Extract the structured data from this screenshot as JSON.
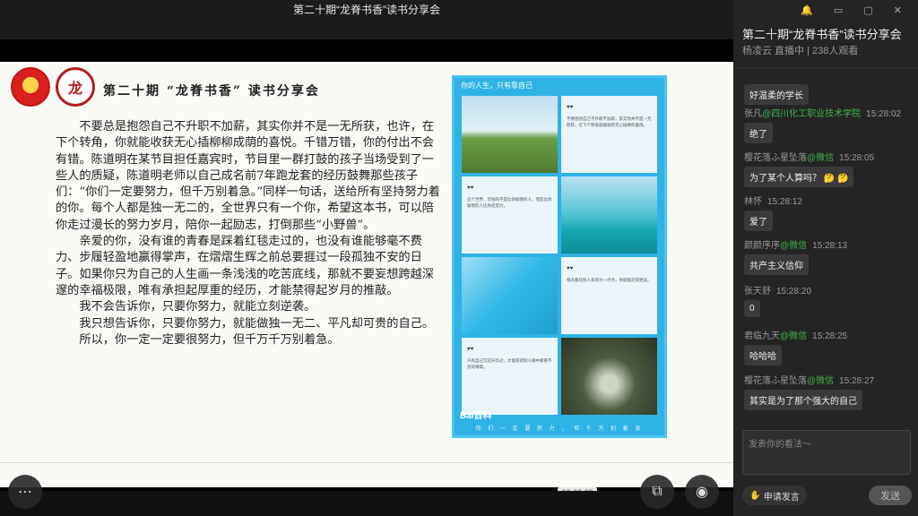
{
  "video": {
    "title": "第二十期“龙脊书香”读书分享会",
    "timecode": "06:02.68"
  },
  "slide": {
    "logo2_char": "龙",
    "heading": "第二十期 “龙脊书香” 读书分享会",
    "paragraphs": [
      "不要总是抱怨自己不升职不加薪，其实你并不是一无所获，也许，在下个转角，你就能收获无心插柳柳成荫的喜悦。千错万错，你的付出不会有错。陈道明在某节目担任嘉宾时，节目里一群打鼓的孩子当场受到了一些人的质疑，陈道明老师以自己成名前7年跑龙套的经历鼓舞那些孩子们：“你们一定要努力，但千万别着急。”同样一句话，送给所有坚持努力着的你。每个人都是独一无二的，全世界只有一个你，希望这本书，可以陪你走过漫长的努力岁月，陪你一起励志，打倒那些“小野兽”。",
      "亲爱的你，没有谁的青春是踩着红毯走过的，也没有谁能够毫不费力、步履轻盈地赢得掌声，在熠熠生辉之前总要捱过一段孤独不安的日子。如果你只为自己的人生画一条浅浅的吃苦底线，那就不要妄想跨越深邃的幸福极限，唯有承担起厚重的经历，才能禁得起岁月的推敲。",
      "我不会告诉你，只要你努力，就能立刻逆袭。",
      "我只想告诉你，只要你努力，就能做独一无二、平凡却可贵的自己。",
      "所以，你一定一定要很努力，但千万千万别着急。"
    ]
  },
  "poster": {
    "title": "你的人生，只有靠自己",
    "hearts": "♥♥",
    "card_texts": [
      "不要抱怨自己不升职不加薪，其实你并不是一无所获，在下个转角就能收获无心插柳的喜悦。",
      "这个世界，可怕的不是比你聪明的人，而是比你聪明的人比你还努力。",
      "每天都比别人多努力一点点，你就能走得更远。",
      "只有自己沉淀升华过，才能获得别人眼中那看不见的璀璨。"
    ],
    "brand": "Bai百科",
    "footer": "你 们 一 定 要 努 力 ， 但 千 万 别 着 急"
  },
  "controls": {
    "more": "⋯",
    "screen": "⧉",
    "eye": "◉"
  },
  "chat": {
    "window_controls": "🔔 ▭ ▢ ✕",
    "title": "第二十期“龙脊书香”读书分享会",
    "subtitle": "杨凌云 直播中 | 238人观看",
    "messages": [
      {
        "name": "",
        "source": "",
        "time": "",
        "text": "好温柔的学长"
      },
      {
        "name": "张凡",
        "source": "@四川化工职业技术学院",
        "time": "15:28:02",
        "text": "绝了"
      },
      {
        "name": "樱花落ふ星坠落",
        "source": "@微信",
        "time": "15:28:05",
        "text": "为了某个人算吗？ 🤔 🤔"
      },
      {
        "name": "林怀",
        "source": "",
        "time": "15:28:12",
        "text": "爱了"
      },
      {
        "name": "颜颜序序",
        "source": "@微信",
        "time": "15:28:13",
        "text": "共产主义信仰"
      },
      {
        "name": "张天舒",
        "source": "",
        "time": "15:28:20",
        "text": "0"
      },
      {
        "name": "君临九天",
        "source": "@微信",
        "time": "15:28:25",
        "text": "哈哈哈"
      },
      {
        "name": "樱花落ふ星坠落",
        "source": "@微信",
        "time": "15:28:27",
        "text": "其实是为了那个强大的自己"
      }
    ],
    "input_placeholder": "发表你的看法～",
    "apply_label": "申请发言",
    "send_label": "发送"
  }
}
